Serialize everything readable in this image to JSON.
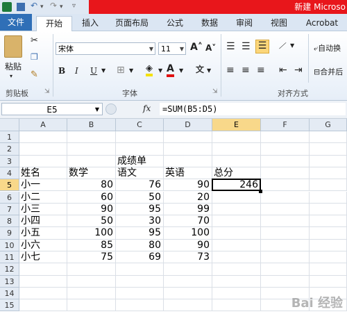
{
  "window": {
    "title": "新建 Microso"
  },
  "tabs": [
    {
      "label": "文件"
    },
    {
      "label": "开始"
    },
    {
      "label": "插入"
    },
    {
      "label": "页面布局"
    },
    {
      "label": "公式"
    },
    {
      "label": "数据"
    },
    {
      "label": "审阅"
    },
    {
      "label": "视图"
    },
    {
      "label": "Acrobat"
    }
  ],
  "ribbon": {
    "clipboard": {
      "paste_label": "粘贴",
      "group_label": "剪贴板"
    },
    "font": {
      "font_name": "宋体",
      "font_size": "11",
      "bold": "B",
      "italic": "I",
      "underline": "U",
      "group_label": "字体"
    },
    "alignment": {
      "group_label": "对齐方式",
      "wrap_label": "自动换",
      "merge_label": "合并后"
    }
  },
  "formula_bar": {
    "name_box": "E5",
    "fx": "fx",
    "formula": "=SUM(B5:D5)"
  },
  "grid": {
    "columns": [
      "A",
      "B",
      "C",
      "D",
      "E",
      "F",
      "G"
    ],
    "rows": [
      "1",
      "2",
      "3",
      "4",
      "5",
      "6",
      "7",
      "8",
      "9",
      "10",
      "11",
      "12",
      "13",
      "14",
      "15"
    ],
    "selected_cell": "E5",
    "cells": {
      "C3": "成绩单",
      "A4": "姓名",
      "B4": "数学",
      "C4": "语文",
      "D4": "英语",
      "E4": "总分",
      "A5": "小一",
      "B5": "80",
      "C5": "76",
      "D5": "90",
      "E5": "246",
      "A6": "小二",
      "B6": "60",
      "C6": "50",
      "D6": "20",
      "A7": "小三",
      "B7": "90",
      "C7": "95",
      "D7": "99",
      "A8": "小四",
      "B8": "50",
      "C8": "30",
      "D8": "70",
      "A9": "小五",
      "B9": "100",
      "C9": "95",
      "D9": "100",
      "A10": "小六",
      "B10": "85",
      "C10": "80",
      "D10": "90",
      "A11": "小七",
      "B11": "75",
      "C11": "69",
      "D11": "73"
    }
  },
  "watermark": "Bai 经验",
  "colors": {
    "accent": "#2f6fb7",
    "title_red": "#e8161b",
    "selected_header": "#f8d88a"
  }
}
